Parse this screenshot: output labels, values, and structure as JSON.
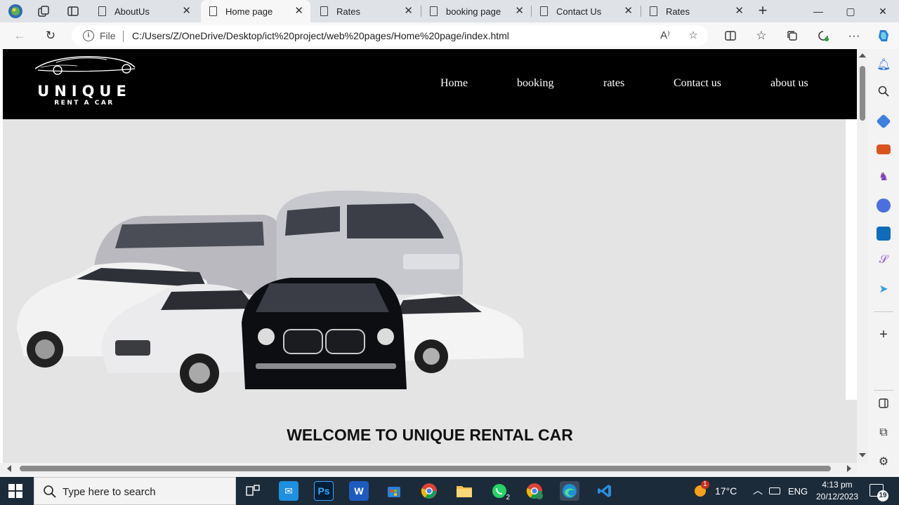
{
  "browser": {
    "tabs": [
      {
        "title": "AboutUs",
        "active": false
      },
      {
        "title": "Home page",
        "active": true
      },
      {
        "title": "Rates",
        "active": false
      },
      {
        "title": "booking page",
        "active": false
      },
      {
        "title": "Contact Us",
        "active": false
      },
      {
        "title": "Rates",
        "active": false
      }
    ],
    "new_tab_label": "+",
    "window_controls": {
      "minimize": "—",
      "maximize": "▢",
      "close": "✕"
    },
    "address_bar": {
      "scheme_label": "File",
      "url": "C:/Users/Z/OneDrive/Desktop/ict%20project/web%20pages/Home%20page/index.html"
    }
  },
  "page": {
    "brand": {
      "name": "UNIQUE",
      "tagline": "RENT A CAR"
    },
    "nav": [
      "Home",
      "booking",
      "rates",
      "Contact us",
      "about us"
    ],
    "hero_image": "car-fleet-photo",
    "welcome_heading": "WELCOME TO UNIQUE RENTAL CAR"
  },
  "taskbar": {
    "search_placeholder": "Type here to search",
    "apps": [
      {
        "name": "task-view",
        "badge": ""
      },
      {
        "name": "mail",
        "badge": ""
      },
      {
        "name": "photoshop",
        "label": "Ps",
        "badge": ""
      },
      {
        "name": "word",
        "label": "W",
        "badge": ""
      },
      {
        "name": "microsoft-store",
        "badge": ""
      },
      {
        "name": "chrome",
        "badge": ""
      },
      {
        "name": "file-explorer",
        "badge": ""
      },
      {
        "name": "whatsapp",
        "badge": "2"
      },
      {
        "name": "chrome-profile",
        "badge": ""
      },
      {
        "name": "edge",
        "badge": ""
      },
      {
        "name": "vscode",
        "badge": ""
      }
    ],
    "weather": {
      "temperature": "17°C",
      "alert_count": "1"
    },
    "language": "ENG",
    "time": "4:13 pm",
    "date": "20/12/2023",
    "notification_count": "19"
  },
  "colors": {
    "site_header_bg": "#000000",
    "hero_bg": "#e4e4e4",
    "taskbar_bg": "#1c2b3a",
    "tabstrip_bg": "#dfe3e8"
  }
}
